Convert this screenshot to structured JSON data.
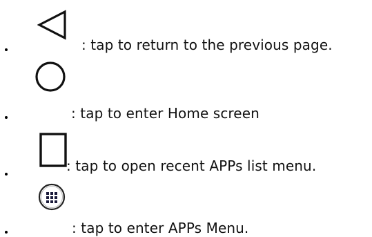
{
  "items": [
    {
      "icon": "back-triangle-icon",
      "text": ": tap to return to the previous page."
    },
    {
      "icon": "home-circle-icon",
      "text": ": tap to enter Home screen"
    },
    {
      "icon": "recent-apps-square-icon",
      "text": ": tap to open recent APPs list menu."
    },
    {
      "icon": "apps-menu-grid-icon",
      "text": ": tap to enter APPs Menu."
    }
  ]
}
